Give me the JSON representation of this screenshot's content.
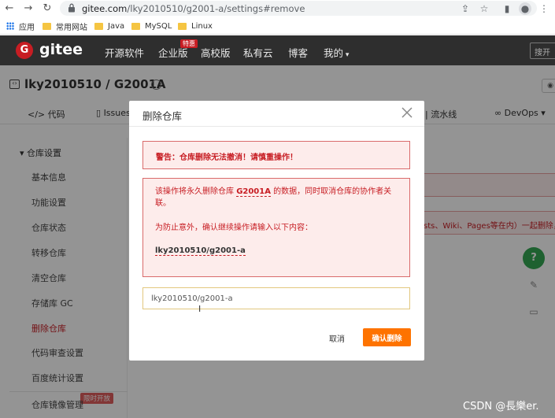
{
  "browser": {
    "url_host": "gitee.com",
    "url_path": "/lky2010510/g2001-a/settings#remove",
    "bookmarks": [
      "应用",
      "常用网站",
      "Java",
      "MySQL",
      "Linux"
    ]
  },
  "header": {
    "logo_letter": "G",
    "brand": "gitee",
    "nav": [
      "开源软件",
      "企业版",
      "高校版",
      "私有云",
      "博客",
      "我的"
    ],
    "enterprise_badge": "特惠",
    "search_placeholder": "搜开"
  },
  "repo": {
    "title": "lky2010510 / G2001A",
    "tabs": [
      "代码",
      "Issues",
      "流水线",
      "DevOps"
    ]
  },
  "sidebar": {
    "group_title": "仓库设置",
    "items": [
      "基本信息",
      "功能设置",
      "仓库状态",
      "转移仓库",
      "清空仓库",
      "存储库 GC",
      "删除仓库",
      "代码审查设置",
      "百度统计设置"
    ],
    "mirror_item": "仓库镜像管理",
    "mirror_badge": "限时开放"
  },
  "background": {
    "alert_text": "sts、Wiki、Pages等在内）一起删除，"
  },
  "modal": {
    "title": "删除仓库",
    "warning_title": "警告：仓库删除无法撤消！请慎重操作！",
    "desc_prefix": "该操作将永久删除仓库",
    "desc_repo": "G2001A",
    "desc_suffix": "的数据，同时取消仓库的协作者关",
    "desc_line2": "联。",
    "confirm_hint": "为防止意外，确认继续操作请输入以下内容：",
    "confirm_target": "lky2010510/g2001-a",
    "input_value": "lky2010510/g2001-a",
    "cancel_label": "取消",
    "confirm_label": "确认删除"
  },
  "watermark": "CSDN @長樂er.",
  "colors": {
    "brand_red": "#c71d23",
    "confirm_orange": "#fe7300",
    "float_green": "#34a853"
  }
}
